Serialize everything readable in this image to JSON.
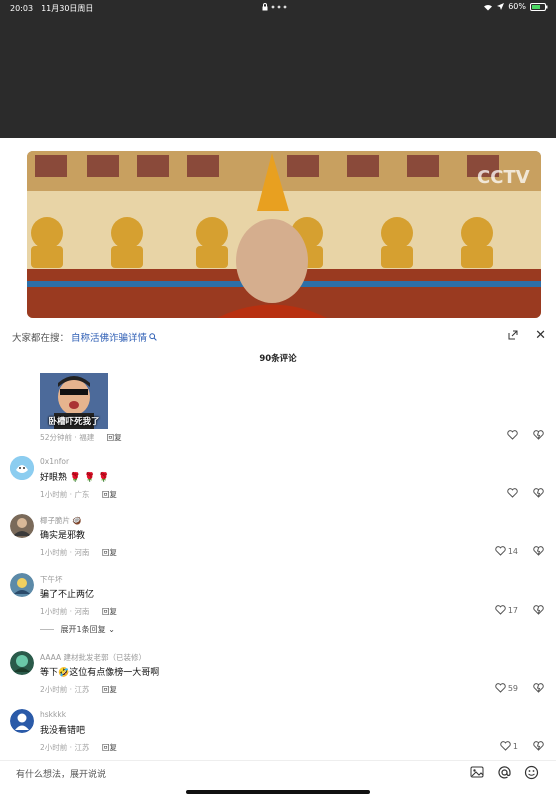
{
  "status_bar": {
    "time": "20:03",
    "date": "11月30日周日",
    "battery": "60%"
  },
  "search_suggestion": {
    "prefix": "大家都在搜：",
    "term": "自称活佛诈骗详情"
  },
  "video": {
    "watermark": "CCTV"
  },
  "comments_count": "90条评论",
  "comments": [
    {
      "meme_caption": "卧槽吓死我了",
      "time": "52分钟前",
      "location": "福建",
      "reply": "回复"
    },
    {
      "username": "0x1nfor",
      "text": "好眼熟",
      "time": "1小时前",
      "location": "广东",
      "reply": "回复"
    },
    {
      "username": "椰子脆片",
      "text": "确实是邪教",
      "time": "1小时前",
      "location": "河南",
      "reply": "回复",
      "likes": "14"
    },
    {
      "username": "下午坏",
      "text": "骗了不止两亿",
      "time": "1小时前",
      "location": "河南",
      "reply": "回复",
      "likes": "17",
      "expand": "展开1条回复"
    },
    {
      "username": "AAAA 建材批发老郭（已装修）",
      "text_before": "等下",
      "text_after": "这位有点像榜一大哥啊",
      "time": "2小时前",
      "location": "江苏",
      "reply": "回复",
      "likes": "59"
    },
    {
      "username": "hskkkk",
      "text": "我没看错吧",
      "time": "2小时前",
      "location": "江苏",
      "reply": "回复",
      "likes": "1"
    }
  ],
  "input": {
    "placeholder": "有什么想法，展开说说"
  },
  "colors": {
    "link": "#2f5fb5",
    "dark_bg": "#2b2b2b"
  }
}
